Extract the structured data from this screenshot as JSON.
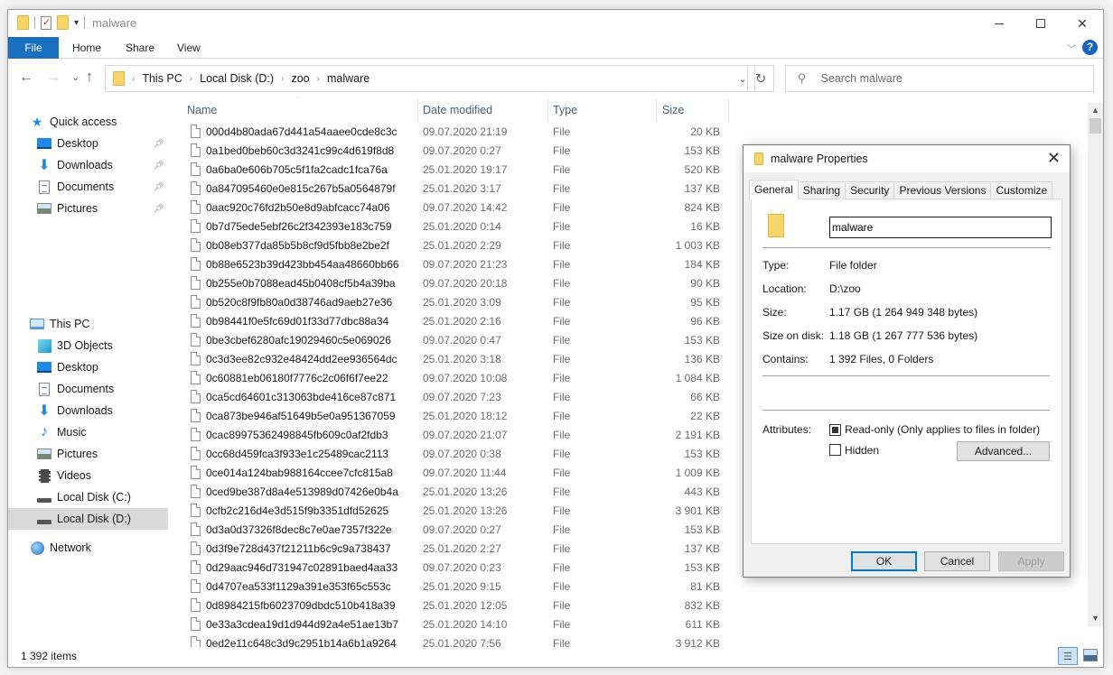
{
  "window": {
    "title": "malware",
    "controls": {
      "minimize": "—",
      "maximize": "□",
      "close": "✕"
    }
  },
  "ribbon": {
    "tabs": [
      {
        "label": "File"
      },
      {
        "label": "Home"
      },
      {
        "label": "Share"
      },
      {
        "label": "View"
      }
    ],
    "help": "?"
  },
  "navigation": {
    "back": "←",
    "forward": "→",
    "recent": "⌄",
    "up": "↑",
    "breadcrumb": [
      "This PC",
      "Local Disk (D:)",
      "zoo",
      "malware"
    ],
    "refresh": "↻",
    "search_placeholder": "Search malware",
    "search_value": ""
  },
  "sidebar": {
    "quick_access": {
      "label": "Quick access",
      "items": [
        {
          "label": "Desktop",
          "icon": "desktop-icon",
          "pinned": true
        },
        {
          "label": "Downloads",
          "icon": "downloads-icon",
          "pinned": true
        },
        {
          "label": "Documents",
          "icon": "documents-icon",
          "pinned": true
        },
        {
          "label": "Pictures",
          "icon": "pictures-icon",
          "pinned": true
        }
      ]
    },
    "this_pc": {
      "label": "This PC",
      "items": [
        {
          "label": "3D Objects",
          "icon": "3d-objects-icon"
        },
        {
          "label": "Desktop",
          "icon": "desktop-icon"
        },
        {
          "label": "Documents",
          "icon": "documents-icon"
        },
        {
          "label": "Downloads",
          "icon": "downloads-icon"
        },
        {
          "label": "Music",
          "icon": "music-icon"
        },
        {
          "label": "Pictures",
          "icon": "pictures-icon"
        },
        {
          "label": "Videos",
          "icon": "videos-icon"
        },
        {
          "label": "Local Disk (C:)",
          "icon": "drive-icon"
        },
        {
          "label": "Local Disk (D:)",
          "icon": "drive-icon",
          "selected": true
        }
      ]
    },
    "network": {
      "label": "Network"
    }
  },
  "filelist": {
    "columns": {
      "name": "Name",
      "date": "Date modified",
      "type": "Type",
      "size": "Size"
    },
    "sort_indicator": "^",
    "rows": [
      {
        "name": "000d4b80ada67d441a54aaee0cde8c3c",
        "date": "09.07.2020 21:19",
        "type": "File",
        "size": "20 KB"
      },
      {
        "name": "0a1bed0beb60c3d3241c99c4d619f8d8",
        "date": "09.07.2020 0:27",
        "type": "File",
        "size": "153 KB"
      },
      {
        "name": "0a6ba0e606b705c5f1fa2cadc1fca76a",
        "date": "25.01.2020 19:17",
        "type": "File",
        "size": "520 KB"
      },
      {
        "name": "0a847095460e0e815c267b5a0564879f",
        "date": "25.01.2020 3:17",
        "type": "File",
        "size": "137 KB"
      },
      {
        "name": "0aac920c76fd2b50e8d9abfcacc74a06",
        "date": "09.07.2020 14:42",
        "type": "File",
        "size": "824 KB"
      },
      {
        "name": "0b7d75ede5ebf26c2f342393e183c759",
        "date": "25.01.2020 0:14",
        "type": "File",
        "size": "16 KB"
      },
      {
        "name": "0b08eb377da85b5b8cf9d5fbb8e2be2f",
        "date": "25.01.2020 2:29",
        "type": "File",
        "size": "1 003 KB"
      },
      {
        "name": "0b88e6523b39d423bb454aa48660bb66",
        "date": "09.07.2020 21:23",
        "type": "File",
        "size": "184 KB"
      },
      {
        "name": "0b255e0b7088ead45b0408cf5b4a39ba",
        "date": "09.07.2020 20:18",
        "type": "File",
        "size": "90 KB"
      },
      {
        "name": "0b520c8f9fb80a0d38746ad9aeb27e36",
        "date": "25.01.2020 3:09",
        "type": "File",
        "size": "95 KB"
      },
      {
        "name": "0b98441f0e5fc69d01f33d77dbc88a34",
        "date": "25.01.2020 2:16",
        "type": "File",
        "size": "96 KB"
      },
      {
        "name": "0be3cbef6280afc19029460c5e069026",
        "date": "09.07.2020 0:47",
        "type": "File",
        "size": "153 KB"
      },
      {
        "name": "0c3d3ee82c932e48424dd2ee936564dc",
        "date": "25.01.2020 3:18",
        "type": "File",
        "size": "136 KB"
      },
      {
        "name": "0c60881eb06180f7776c2c06f6f7ee22",
        "date": "09.07.2020 10:08",
        "type": "File",
        "size": "1 084 KB"
      },
      {
        "name": "0ca5cd64601c313063bde416ce87c871",
        "date": "09.07.2020 7:23",
        "type": "File",
        "size": "66 KB"
      },
      {
        "name": "0ca873be946af51649b5e0a951367059",
        "date": "25.01.2020 18:12",
        "type": "File",
        "size": "22 KB"
      },
      {
        "name": "0cac89975362498845fb609c0af2fdb3",
        "date": "09.07.2020 21:07",
        "type": "File",
        "size": "2 191 KB"
      },
      {
        "name": "0cc68d459fca3f933e1c25489cac2113",
        "date": "09.07.2020 0:38",
        "type": "File",
        "size": "153 KB"
      },
      {
        "name": "0ce014a124bab988164ccee7cfc815a8",
        "date": "09.07.2020 11:44",
        "type": "File",
        "size": "1 009 KB"
      },
      {
        "name": "0ced9be387d8a4e513989d07426e0b4a",
        "date": "25.01.2020 13:26",
        "type": "File",
        "size": "443 KB"
      },
      {
        "name": "0cfb2c216d4e3d515f9b3351dfd52625",
        "date": "25.01.2020 13:26",
        "type": "File",
        "size": "3 901 KB"
      },
      {
        "name": "0d3a0d37326f8dec8c7e0ae7357f322e",
        "date": "09.07.2020 0:27",
        "type": "File",
        "size": "153 KB"
      },
      {
        "name": "0d3f9e728d437f21211b6c9c9a738437",
        "date": "25.01.2020 2:27",
        "type": "File",
        "size": "137 KB"
      },
      {
        "name": "0d29aac946d731947c02891baed4aa33",
        "date": "09.07.2020 0:23",
        "type": "File",
        "size": "153 KB"
      },
      {
        "name": "0d4707ea533f1129a391e353f65c553c",
        "date": "25.01.2020 9:15",
        "type": "File",
        "size": "81 KB"
      },
      {
        "name": "0d8984215fb6023709dbdc510b418a39",
        "date": "25.01.2020 12:05",
        "type": "File",
        "size": "832 KB"
      },
      {
        "name": "0e33a3cdea19d1d944d92a4e51ae13b7",
        "date": "25.01.2020 14:10",
        "type": "File",
        "size": "611 KB"
      },
      {
        "name": "0ed2e11c648c3d9c2951b14a6b1a9264",
        "date": "25.01.2020 7:56",
        "type": "File",
        "size": "3 912 KB"
      }
    ]
  },
  "statusbar": {
    "item_count": "1 392 items"
  },
  "properties_dialog": {
    "title": "malware Properties",
    "close": "✕",
    "tabs": [
      "General",
      "Sharing",
      "Security",
      "Previous Versions",
      "Customize"
    ],
    "active_tab": "General",
    "name_value": "malware",
    "fields": [
      {
        "label": "Type:",
        "value": "File folder"
      },
      {
        "label": "Location:",
        "value": "D:\\zoo"
      },
      {
        "label": "Size:",
        "value": "1.17 GB (1 264 949 348 bytes)"
      },
      {
        "label": "Size on disk:",
        "value": "1.18 GB (1 267 777 536 bytes)"
      },
      {
        "label": "Contains:",
        "value": "1 392 Files, 0 Folders"
      }
    ],
    "attributes_label": "Attributes:",
    "readonly_label": "Read-only (Only applies to files in folder)",
    "readonly_state": "indeterminate",
    "hidden_label": "Hidden",
    "hidden_checked": false,
    "advanced_button": "Advanced...",
    "ok_button": "OK",
    "cancel_button": "Cancel",
    "apply_button": "Apply"
  }
}
